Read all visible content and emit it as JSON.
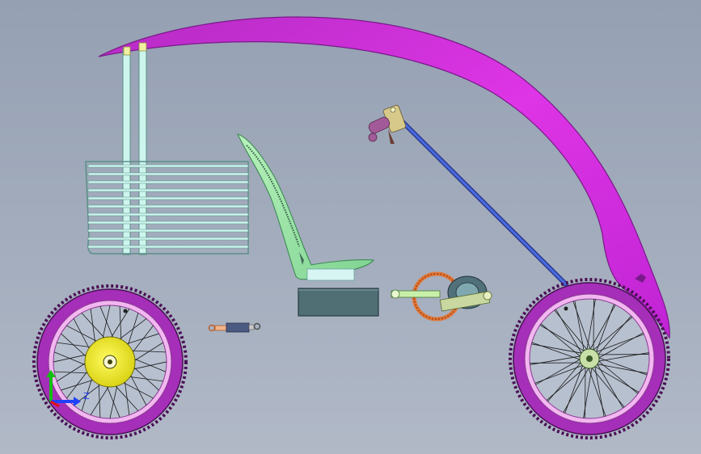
{
  "viewport": {
    "background_top": "#95a0b3",
    "background_bottom": "#b1b9c7"
  },
  "parts": {
    "canopy": {
      "color": "#d92fe0"
    },
    "roof_posts": {
      "color": "#cdf5ee"
    },
    "basket": {
      "color": "#cdf5ee"
    },
    "seat": {
      "color": "#9ee6a6"
    },
    "battery": {
      "color": "#4f6f75"
    },
    "shock_absorber": {
      "color": "#4a5a80"
    },
    "steering_column": {
      "color": "#3050c8"
    },
    "handlebar_grip": {
      "color": "#a25a98"
    },
    "crankset": {
      "color": "#e0783a"
    },
    "motor": {
      "color": "#50707a"
    },
    "wheel_tire": {
      "color": "#a52fb8"
    },
    "wheel_rim": {
      "color": "#f2b7f0"
    },
    "hub_motor": {
      "color": "#f5f020"
    }
  },
  "axis_triad": {
    "y_color": "#10c010",
    "z_color": "#2040ff",
    "x_color": "#e01010",
    "z_label": "Z"
  }
}
